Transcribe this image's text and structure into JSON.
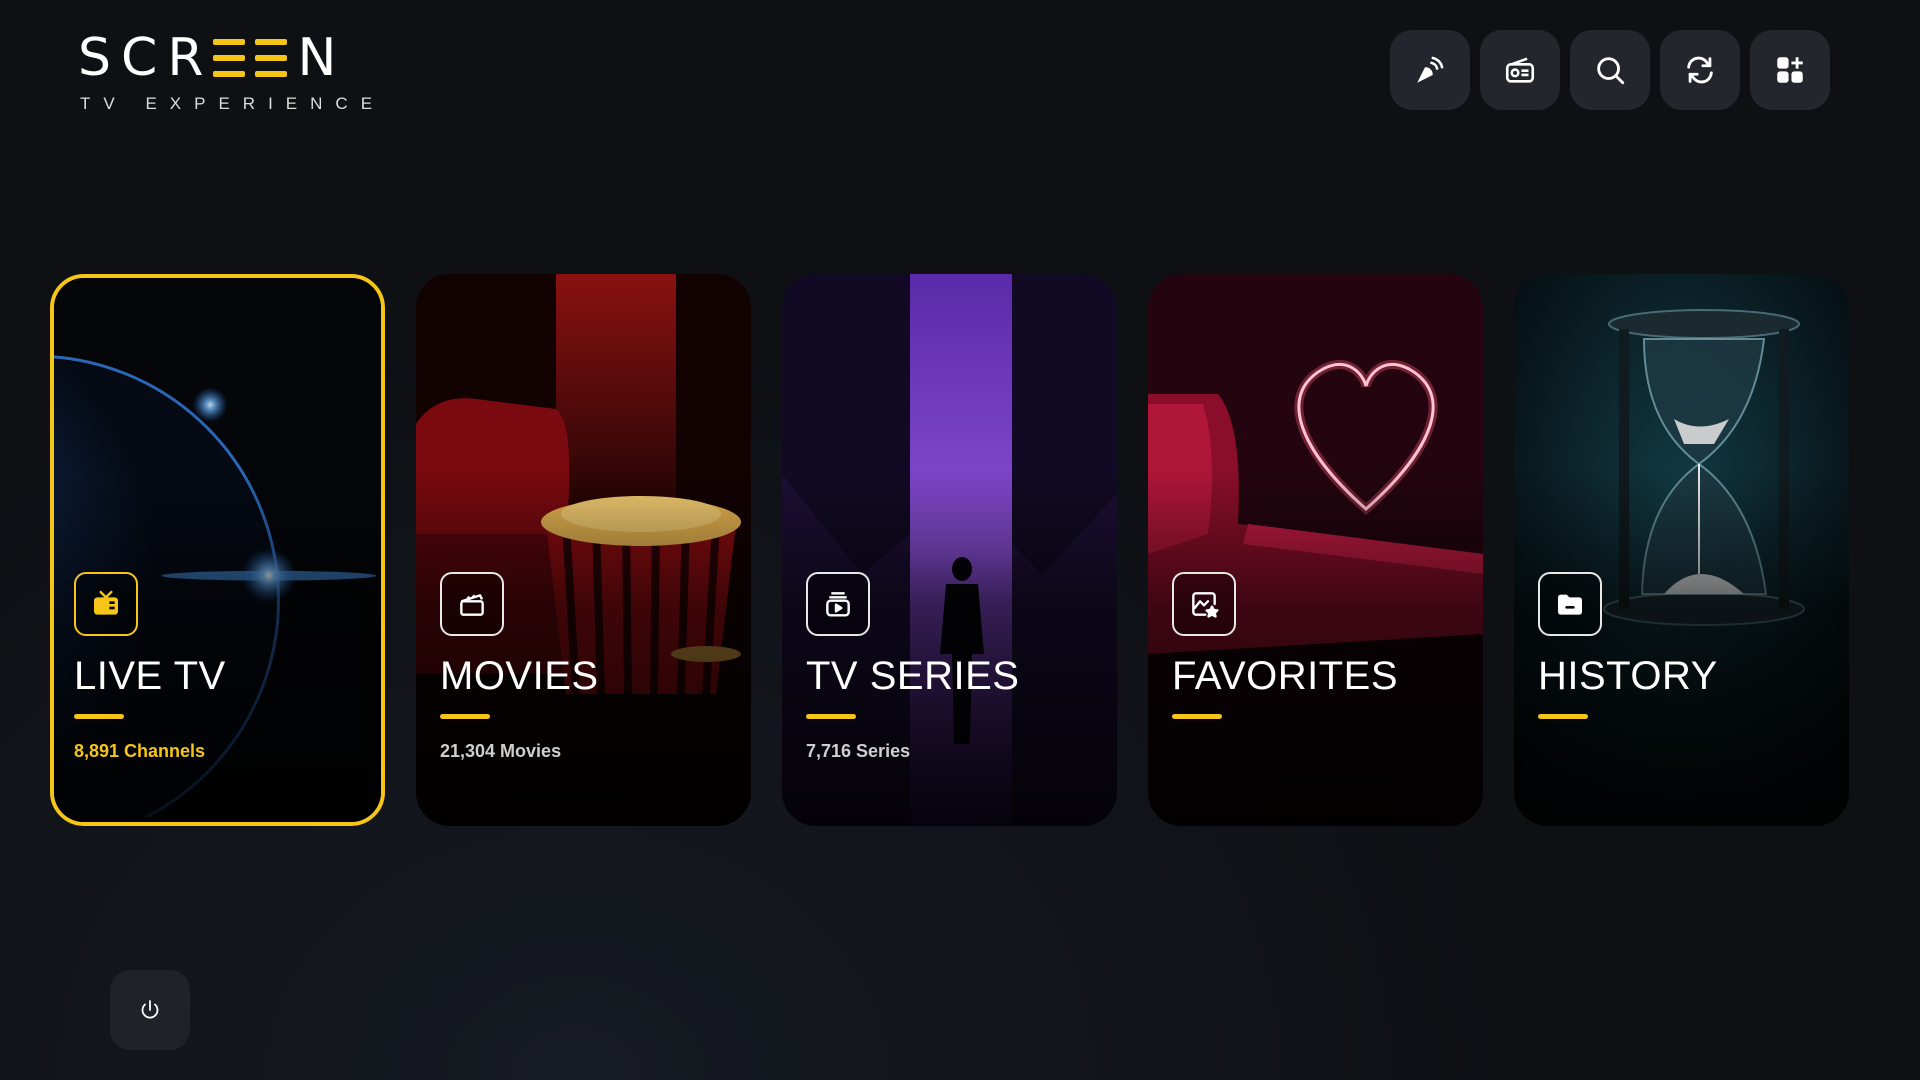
{
  "logo": {
    "part1": "SCR",
    "part2": "N",
    "tagline": "TV EXPERIENCE",
    "accent": "#f5c518"
  },
  "toolbar": [
    {
      "icon": "broadcast-icon"
    },
    {
      "icon": "radio-icon"
    },
    {
      "icon": "search-icon"
    },
    {
      "icon": "refresh-icon"
    },
    {
      "icon": "apps-add-icon"
    }
  ],
  "cards": [
    {
      "title": "LIVE TV",
      "count": "8,891 Channels",
      "icon": "tv-icon",
      "selected": true
    },
    {
      "title": "MOVIES",
      "count": "21,304 Movies",
      "icon": "clapperboard-icon",
      "selected": false
    },
    {
      "title": "TV SERIES",
      "count": "7,716 Series",
      "icon": "play-stack-icon",
      "selected": false
    },
    {
      "title": "FAVORITES",
      "count": "",
      "icon": "favorite-image-icon",
      "selected": false
    },
    {
      "title": "HISTORY",
      "count": "",
      "icon": "folder-icon",
      "selected": false
    }
  ],
  "power": {
    "icon": "power-icon"
  },
  "colors": {
    "accent": "#f5c518",
    "background": "#0e1014",
    "button": "#23262c"
  }
}
